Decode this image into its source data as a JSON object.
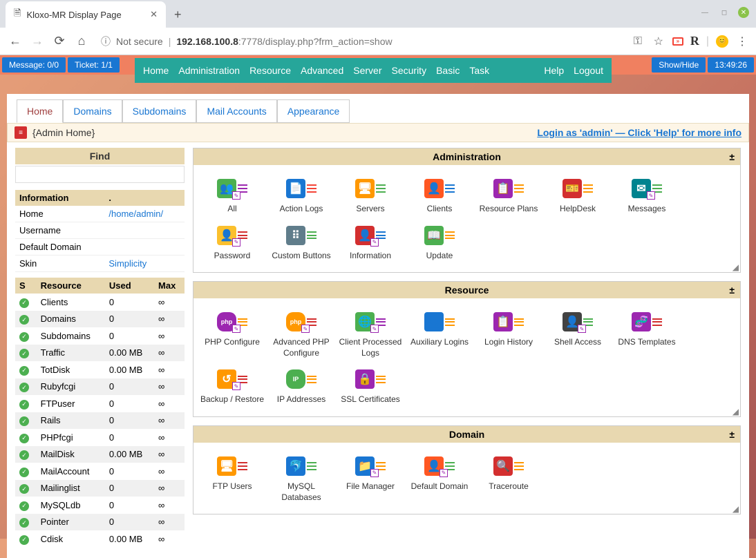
{
  "browser": {
    "tab_title": "Kloxo-MR Display Page",
    "not_secure": "Not secure",
    "url_host": "192.168.100.8",
    "url_port_path": ":7778/display.php?frm_action=show"
  },
  "status": {
    "message": "Message: 0/0",
    "ticket": "Ticket: 1/1",
    "showhide": "Show/Hide",
    "clock": "13:49:26"
  },
  "nav": {
    "items": [
      "Home",
      "Administration",
      "Resource",
      "Advanced",
      "Server",
      "Security",
      "Basic",
      "Task"
    ],
    "right": [
      "Help",
      "Logout"
    ]
  },
  "tabs": [
    "Home",
    "Domains",
    "Subdomains",
    "Mail Accounts",
    "Appearance"
  ],
  "breadcrumb": {
    "text": "{Admin Home}",
    "help": "Login as 'admin' — Click 'Help' for more info"
  },
  "sidebar": {
    "find_label": "Find",
    "info": {
      "header1": "Information",
      "header2": ".",
      "rows": [
        {
          "k": "Home",
          "v": "/home/admin/",
          "link": true
        },
        {
          "k": "Username",
          "v": ""
        },
        {
          "k": "Default Domain",
          "v": ""
        },
        {
          "k": "Skin",
          "v": "Simplicity",
          "link": true
        }
      ]
    },
    "resources": {
      "headers": [
        "S",
        "Resource",
        "Used",
        "Max"
      ],
      "rows": [
        {
          "name": "Clients",
          "used": "0",
          "max": "∞"
        },
        {
          "name": "Domains",
          "used": "0",
          "max": "∞"
        },
        {
          "name": "Subdomains",
          "used": "0",
          "max": "∞"
        },
        {
          "name": "Traffic",
          "used": "0.00 MB",
          "max": "∞"
        },
        {
          "name": "TotDisk",
          "used": "0.00 MB",
          "max": "∞"
        },
        {
          "name": "Rubyfcgi",
          "used": "0",
          "max": "∞"
        },
        {
          "name": "FTPuser",
          "used": "0",
          "max": "∞"
        },
        {
          "name": "Rails",
          "used": "0",
          "max": "∞"
        },
        {
          "name": "PHPfcgi",
          "used": "0",
          "max": "∞"
        },
        {
          "name": "MailDisk",
          "used": "0.00 MB",
          "max": "∞"
        },
        {
          "name": "MailAccount",
          "used": "0",
          "max": "∞"
        },
        {
          "name": "Mailinglist",
          "used": "0",
          "max": "∞"
        },
        {
          "name": "MySQLdb",
          "used": "0",
          "max": "∞"
        },
        {
          "name": "Pointer",
          "used": "0",
          "max": "∞"
        },
        {
          "name": "Cdisk",
          "used": "0.00 MB",
          "max": "∞"
        }
      ]
    }
  },
  "panels": [
    {
      "title": "Administration",
      "items": [
        {
          "label": "All",
          "color": "#4caf50",
          "glyph": "👥",
          "list": "#9c27b0",
          "edit": true
        },
        {
          "label": "Action Logs",
          "color": "#1976d2",
          "glyph": "📄",
          "list": "#f44336"
        },
        {
          "label": "Servers",
          "color": "#ff9800",
          "glyph": "🖥",
          "list": "#4caf50"
        },
        {
          "label": "Clients",
          "color": "#ff5722",
          "glyph": "👤",
          "list": "#1976d2"
        },
        {
          "label": "Resource Plans",
          "color": "#9c27b0",
          "glyph": "📋",
          "list": "#ff9800"
        },
        {
          "label": "HelpDesk",
          "color": "#d32f2f",
          "glyph": "🎫",
          "list": "#ff9800"
        },
        {
          "label": "Messages",
          "color": "#00838f",
          "glyph": "✉",
          "list": "#4caf50",
          "edit": true
        },
        {
          "label": "Password",
          "color": "#fbc02d",
          "glyph": "👤",
          "list": "#d32f2f",
          "edit": true
        },
        {
          "label": "Custom Buttons",
          "color": "#607d8b",
          "glyph": "⠿",
          "list": "#4caf50"
        },
        {
          "label": "Information",
          "color": "#d32f2f",
          "glyph": "👤",
          "list": "#1976d2",
          "edit": true
        },
        {
          "label": "Update",
          "color": "#4caf50",
          "glyph": "📖",
          "list": "#ff9800"
        }
      ]
    },
    {
      "title": "Resource",
      "items": [
        {
          "label": "PHP Configure",
          "color": "#9c27b0",
          "glyph": "php",
          "list": "#ff9800",
          "edit": true,
          "small": true
        },
        {
          "label": "Advanced PHP Configure",
          "color": "#ff9800",
          "glyph": "php",
          "list": "#d32f2f",
          "edit": true,
          "small": true
        },
        {
          "label": "Client Processed Logs",
          "color": "#4caf50",
          "glyph": "🌐",
          "list": "#9c27b0",
          "edit": true
        },
        {
          "label": "Auxiliary Logins",
          "color": "#1976d2",
          "glyph": "👤",
          "list": "#ff9800"
        },
        {
          "label": "Login History",
          "color": "#9c27b0",
          "glyph": "📋",
          "list": "#ff9800"
        },
        {
          "label": "Shell Access",
          "color": "#424242",
          "glyph": "👤",
          "list": "#4caf50",
          "edit": true
        },
        {
          "label": "DNS Templates",
          "color": "#9c27b0",
          "glyph": "🧬",
          "list": "#d32f2f"
        },
        {
          "label": "Backup / Restore",
          "color": "#ff9800",
          "glyph": "↺",
          "list": "#d32f2f",
          "edit": true
        },
        {
          "label": "IP Addresses",
          "color": "#4caf50",
          "glyph": "IP",
          "list": "#ff9800",
          "small": true
        },
        {
          "label": "SSL Certificates",
          "color": "#9c27b0",
          "glyph": "🔒",
          "list": "#ff9800"
        }
      ]
    },
    {
      "title": "Domain",
      "items": [
        {
          "label": "FTP Users",
          "color": "#ff9800",
          "glyph": "🖥",
          "list": "#d32f2f"
        },
        {
          "label": "MySQL Databases",
          "color": "#1976d2",
          "glyph": "🐬",
          "list": "#4caf50"
        },
        {
          "label": "File Manager",
          "color": "#1976d2",
          "glyph": "📁",
          "list": "#ff9800",
          "edit": true
        },
        {
          "label": "Default Domain",
          "color": "#ff5722",
          "glyph": "👤",
          "list": "#4caf50",
          "edit": true
        },
        {
          "label": "Traceroute",
          "color": "#d32f2f",
          "glyph": "🔍",
          "list": "#ff9800"
        }
      ]
    }
  ]
}
